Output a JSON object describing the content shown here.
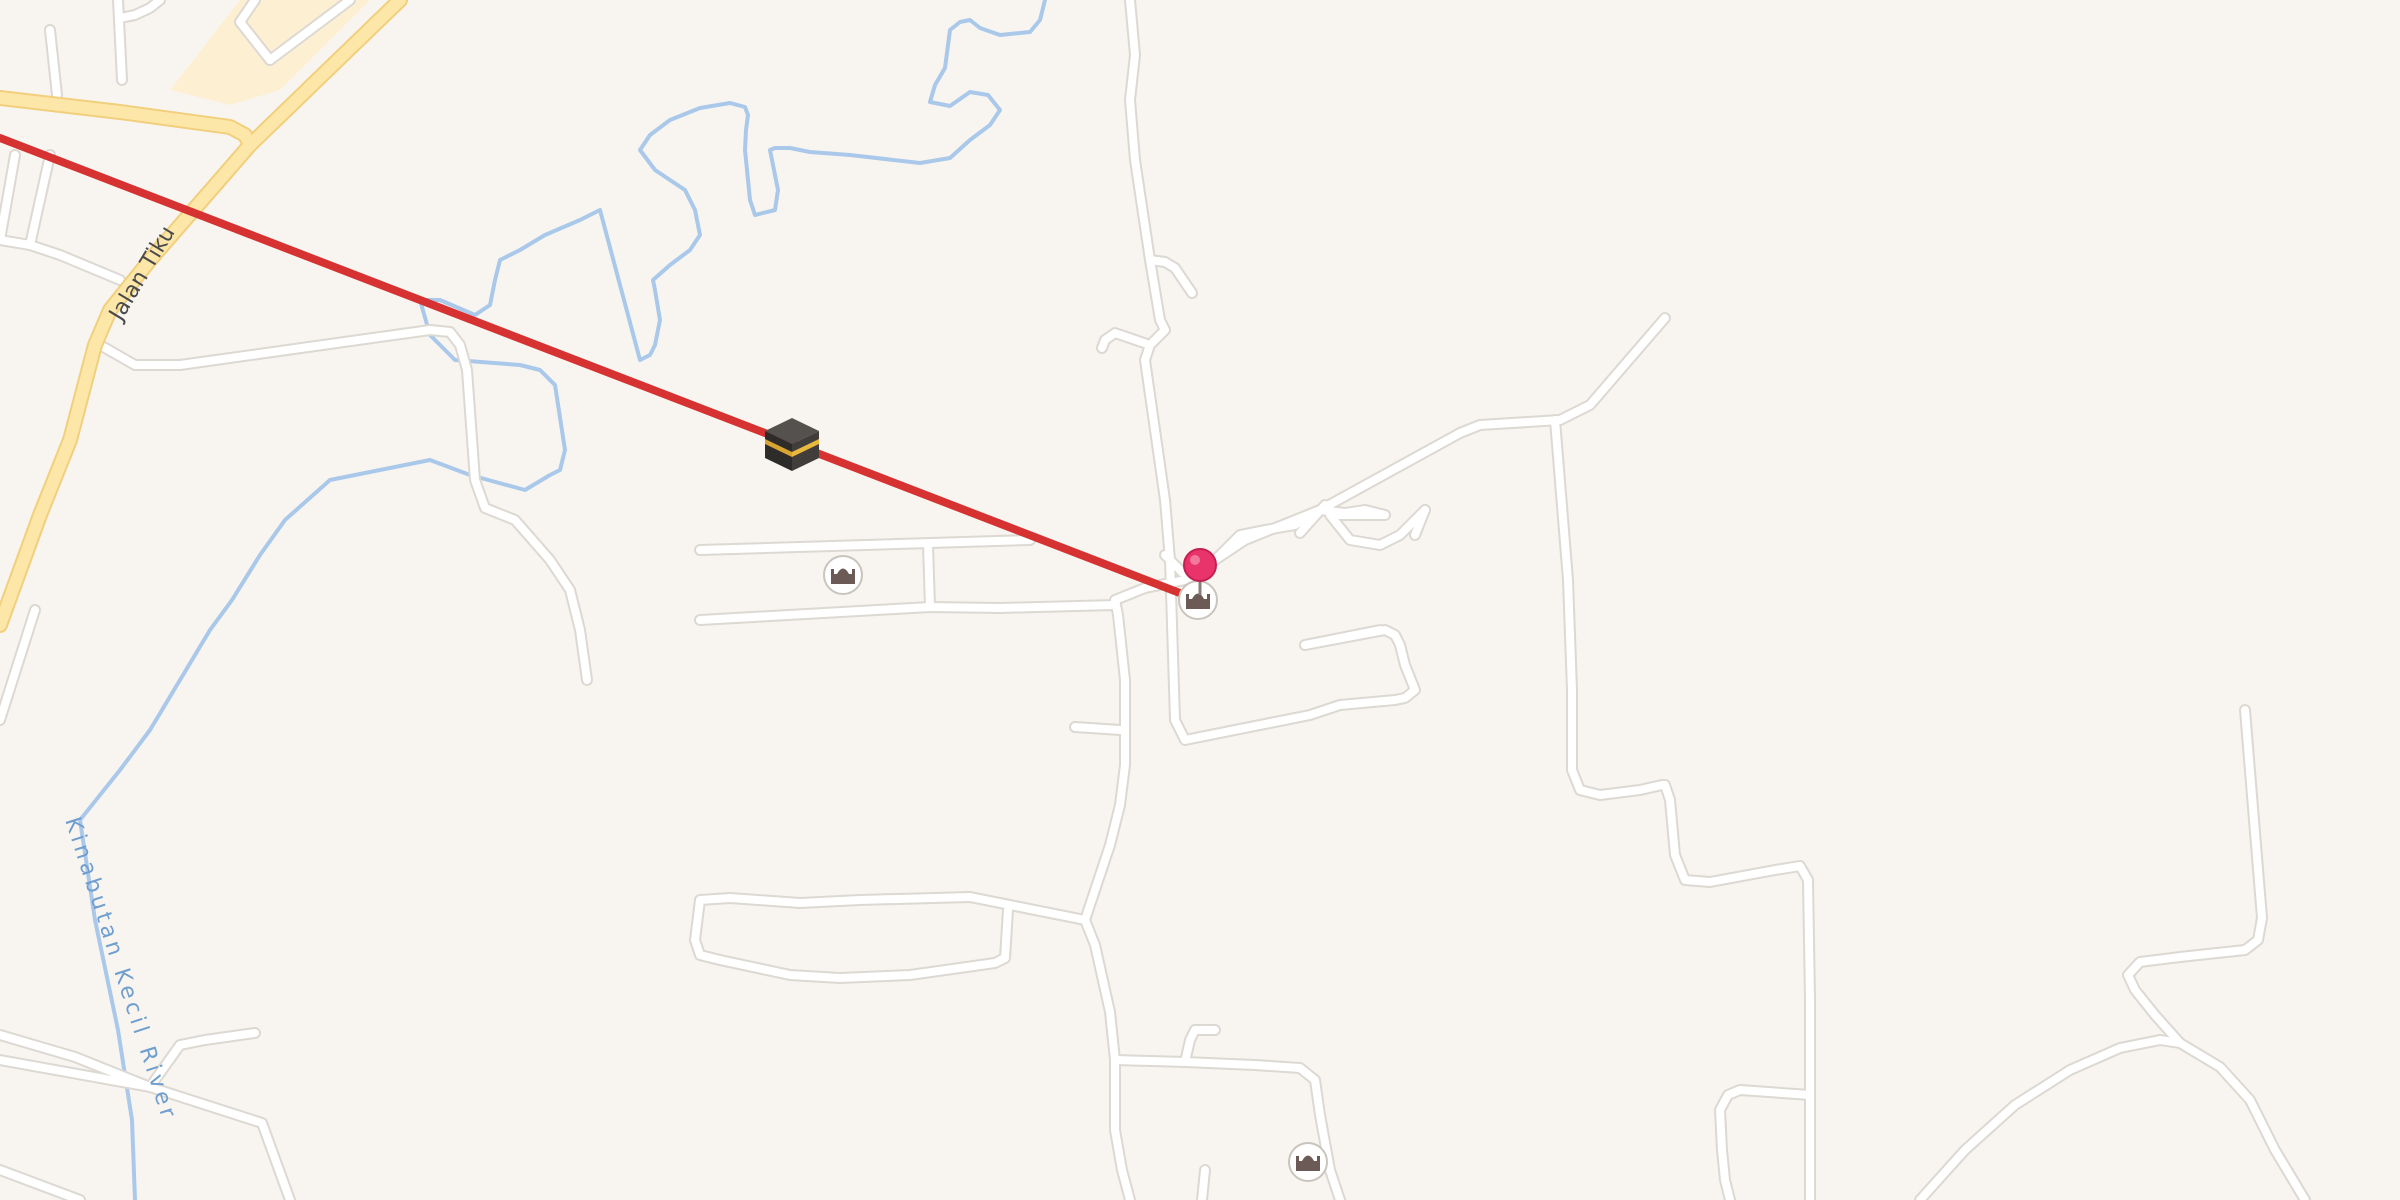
{
  "map": {
    "street_labels": {
      "jalan_tiku": "Jalan Tiku"
    },
    "water_labels": {
      "river": "Kinabutan Kecil River"
    },
    "poi_icons": [
      "kaaba-icon",
      "mosque-icon",
      "mosque-icon",
      "mosque-icon",
      "mosque-icon"
    ],
    "marker": {
      "icon": "map-pin-icon",
      "color": "#e8336b"
    },
    "route": {
      "color": "#d63232"
    },
    "colors": {
      "background": "#f8f5f1",
      "road": "#ffffff",
      "road_casing": "#dcd8d2",
      "main_road": "#fde7a8",
      "main_road_casing": "#f1cf7c",
      "water": "#a9c8ea",
      "built_area": "#fdf0d2"
    }
  }
}
